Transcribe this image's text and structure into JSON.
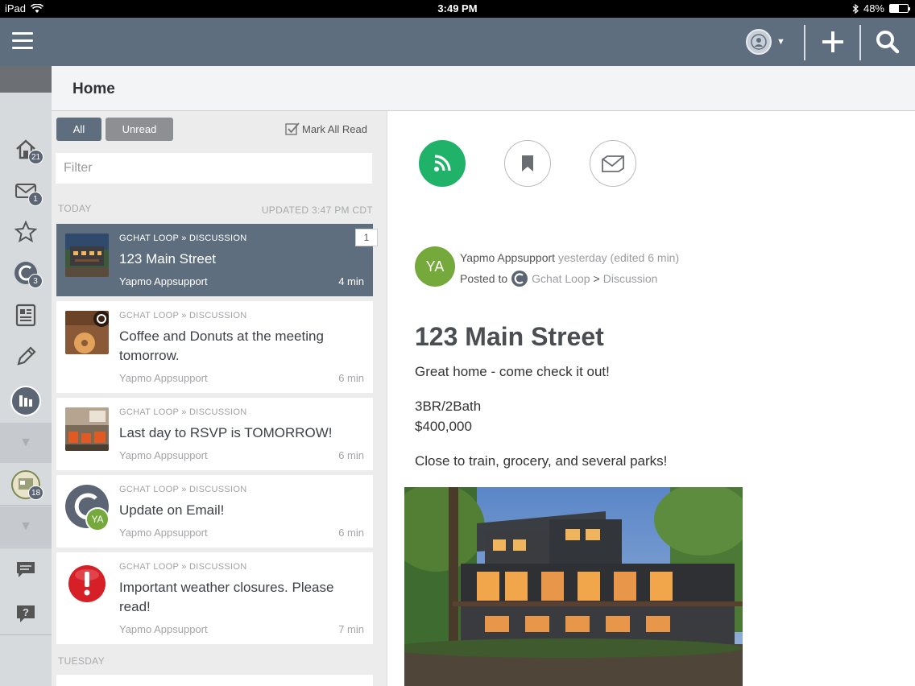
{
  "status_bar": {
    "device": "iPad",
    "time": "3:49 PM",
    "battery": "48%",
    "battery_level": 0.48
  },
  "header": {
    "title": "Home"
  },
  "sidebar": {
    "items": [
      {
        "icon": "home-icon",
        "badge": "21"
      },
      {
        "icon": "mail-icon",
        "badge": "1"
      },
      {
        "icon": "star-icon",
        "badge": ""
      },
      {
        "icon": "loop-icon",
        "badge": "3"
      },
      {
        "icon": "directory-icon",
        "badge": ""
      },
      {
        "icon": "pencil-icon",
        "badge": ""
      },
      {
        "icon": "stats-icon",
        "badge": ""
      },
      {
        "icon": "chevron-down-icon",
        "badge": ""
      },
      {
        "icon": "group-icon",
        "badge": "18"
      },
      {
        "icon": "chevron-down-icon",
        "badge": ""
      },
      {
        "icon": "chat-icon",
        "badge": ""
      },
      {
        "icon": "help-icon",
        "badge": ""
      }
    ]
  },
  "list": {
    "tab_all": "All",
    "tab_unread": "Unread",
    "mark_all_read": "Mark All Read",
    "filter_placeholder": "Filter",
    "today_label": "TODAY",
    "updated_label": "UPDATED 3:47 PM CDT",
    "tuesday_label": "TUESDAY",
    "items": [
      {
        "crumb": "GCHAT LOOP » DISCUSSION",
        "title": "123 Main Street",
        "author": "Yapmo Appsupport",
        "age": "4 min",
        "count": "1",
        "thumb": "house-thumbnail"
      },
      {
        "crumb": "GCHAT LOOP » DISCUSSION",
        "title": "Coffee and Donuts at the meeting tomorrow.",
        "author": "Yapmo Appsupport",
        "age": "6 min",
        "thumb": "donut-thumbnail"
      },
      {
        "crumb": "GCHAT LOOP » DISCUSSION",
        "title": "Last day to RSVP is TOMORROW!",
        "author": "Yapmo Appsupport",
        "age": "6 min",
        "thumb": "venue-thumbnail"
      },
      {
        "crumb": "GCHAT LOOP » DISCUSSION",
        "title": "Update on Email!",
        "author": "Yapmo Appsupport",
        "age": "6 min",
        "thumb": "loop-logo",
        "avatar": "YA"
      },
      {
        "crumb": "GCHAT LOOP » DISCUSSION",
        "title": "Important weather closures. Please read!",
        "author": "Yapmo Appsupport",
        "age": "7 min",
        "thumb": "alert-icon"
      }
    ]
  },
  "detail": {
    "avatar": "YA",
    "author": "Yapmo Appsupport",
    "when": "yesterday",
    "edited": "(edited 6 min)",
    "posted_to": "Posted to",
    "loop": "Gchat Loop",
    "arrow": ">",
    "section": "Discussion",
    "title": "123 Main Street",
    "body_line1": "Great home - come check it out!",
    "body_line2": "3BR/2Bath",
    "body_line3": "$400,000",
    "body_line4": "Close to train, grocery, and several parks!"
  },
  "colors": {
    "app_bar": "#5f6e7f",
    "accent_green": "#21b26a",
    "avatar_green": "#76a93c",
    "alert_red": "#d61f26"
  }
}
